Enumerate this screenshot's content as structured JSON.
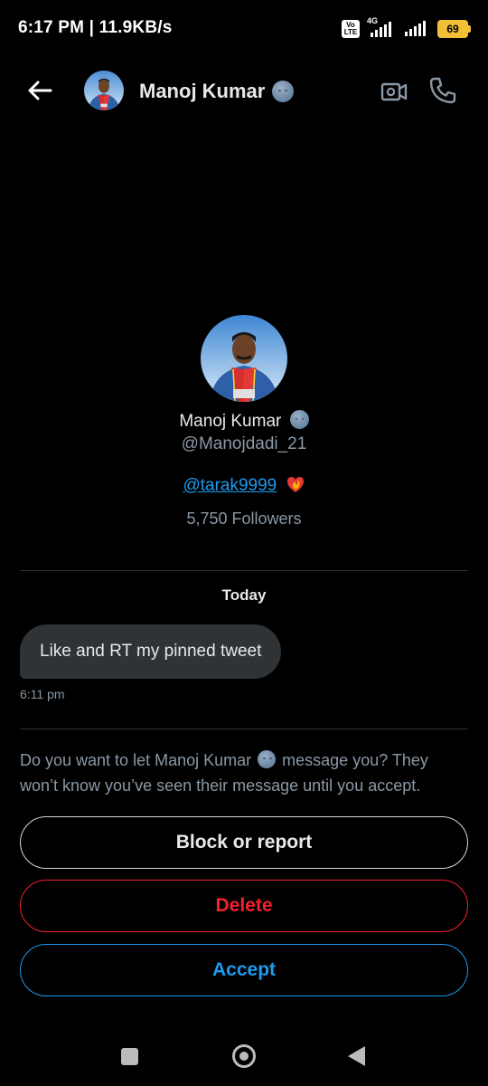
{
  "status_bar": {
    "time": "6:17 PM | 11.9KB/s",
    "network_label": "4G",
    "volte_label": "Vo LTE",
    "battery_level": "69"
  },
  "header": {
    "title": "Manoj Kumar",
    "name_emoji": "moon-face",
    "icons": [
      "back-arrow-icon",
      "video-icon",
      "phone-icon"
    ]
  },
  "profile": {
    "name": "Manoj Kumar",
    "handle": "@Manojdadi_21",
    "bio_mention": "@tarak9999",
    "bio_emoji": "heart-on-fire",
    "followers": "5,750 Followers"
  },
  "conversation": {
    "date_label": "Today",
    "messages": [
      {
        "text": "Like and RT my pinned tweet",
        "time": "6:11 pm"
      }
    ]
  },
  "request": {
    "prompt_start": "Do you want to let Manoj Kumar",
    "prompt_end": "message you? They won’t know you’ve seen their message until you accept.",
    "block_label": "Block or report",
    "delete_label": "Delete",
    "accept_label": "Accept"
  },
  "colors": {
    "background": "#000000",
    "accent": "#1d9bf0",
    "danger": "#f4212e",
    "muted_text": "#8b98a5",
    "bubble": "#2f3336",
    "battery": "#f2c037"
  }
}
